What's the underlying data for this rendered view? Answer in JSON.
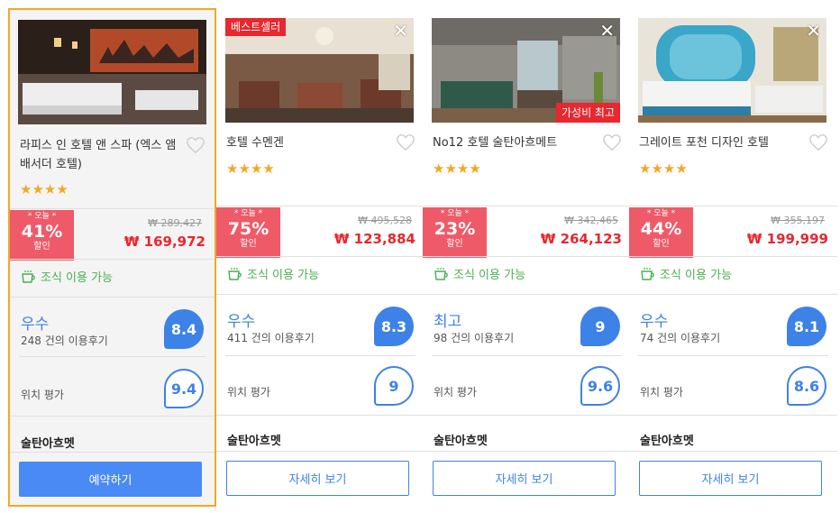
{
  "cards": [
    {
      "name": "라피스 인 호텔 앤 스파 (엑스 앰 배서더 호텔)",
      "stars": "★★★★",
      "badge_top": "",
      "badge_bottom": "",
      "discount_today": "* 오늘 *",
      "discount_pct": "41%",
      "discount_off": "할인",
      "old_price": "₩ 289,427",
      "new_price": "₩ 169,972",
      "breakfast": "조식 이용 가능",
      "rating_word": "우수",
      "review_count": "248 건의 이용후기",
      "score": "8.4",
      "location_label": "위치 평가",
      "location_score": "9.4",
      "area": "술탄아흐멧",
      "button": "예약하기"
    },
    {
      "name": "호텔 수멘겐",
      "stars": "★★★★",
      "badge_top": "베스트셀러",
      "badge_bottom": "",
      "close": "✕",
      "discount_today": "* 오늘 *",
      "discount_pct": "75%",
      "discount_off": "할인",
      "old_price": "₩ 495,528",
      "new_price": "₩ 123,884",
      "breakfast": "조식 이용 가능",
      "rating_word": "우수",
      "review_count": "411 건의 이용후기",
      "score": "8.3",
      "location_label": "위치 평가",
      "location_score": "9",
      "area": "술탄아흐멧",
      "button": "자세히 보기"
    },
    {
      "name": "No12 호텔 술탄아흐메트",
      "stars": "★★★★",
      "badge_top": "",
      "badge_bottom": "가성비 최고",
      "close": "✕",
      "discount_today": "* 오늘 *",
      "discount_pct": "23%",
      "discount_off": "할인",
      "old_price": "₩ 342,465",
      "new_price": "₩ 264,123",
      "breakfast": "조식 이용 가능",
      "rating_word": "최고",
      "review_count": "98 건의 이용후기",
      "score": "9",
      "location_label": "위치 평가",
      "location_score": "9.6",
      "area": "술탄아흐멧",
      "button": "자세히 보기"
    },
    {
      "name": "그레이트 포천 디자인 호텔",
      "stars": "★★★★",
      "badge_top": "",
      "badge_bottom": "",
      "close": "✕",
      "discount_today": "* 오늘 *",
      "discount_pct": "44%",
      "discount_off": "할인",
      "old_price": "₩ 355,197",
      "new_price": "₩ 199,999",
      "breakfast": "조식 이용 가능",
      "rating_word": "우수",
      "review_count": "74 건의 이용후기",
      "score": "8.1",
      "location_label": "위치 평가",
      "location_score": "8.6",
      "area": "술탄아흐멧",
      "button": "자세히 보기"
    }
  ],
  "colors": {
    "accent": "#3d82e6",
    "selected_border": "#f5a623",
    "discount": "#ef5a68",
    "price": "#e8272e",
    "breakfast": "#4caf50",
    "star": "#f5a623"
  },
  "icons": {
    "heart": "heart-outline-icon",
    "close": "close-icon",
    "cup": "coffee-cup-icon",
    "star": "star-icon"
  }
}
